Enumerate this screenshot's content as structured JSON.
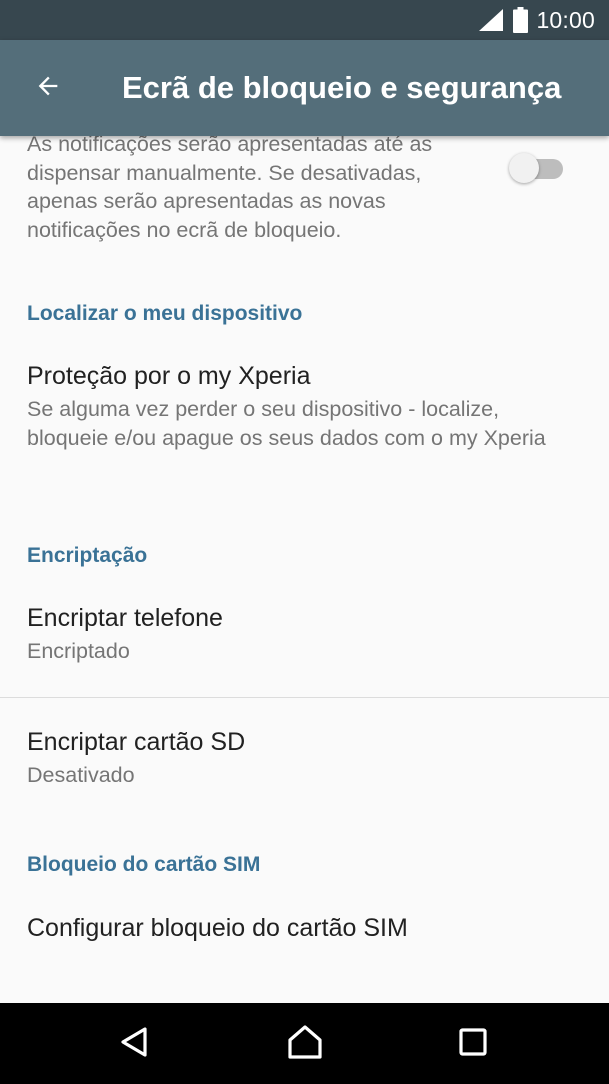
{
  "status_bar": {
    "time": "10:00",
    "icons": [
      "signal-icon",
      "battery-icon"
    ]
  },
  "app_bar": {
    "title": "Ecrã de bloqueio e segurança",
    "back_icon": "arrow-back-icon"
  },
  "notifications_setting": {
    "description": "As notificações serão apresentadas até as dispensar manualmente. Se desativadas, apenas serão apresentadas as novas notificações no ecrã de bloqueio.",
    "toggle_state": "off"
  },
  "sections": {
    "find_device": {
      "header": "Localizar o meu dispositivo",
      "item": {
        "title": "Proteção por o my Xperia",
        "summary": "Se alguma vez perder o seu dispositivo - localize, bloqueie e/ou apague os seus dados com o my Xperia"
      }
    },
    "encryption": {
      "header": "Encriptação",
      "phone": {
        "title": "Encriptar telefone",
        "summary": "Encriptado"
      },
      "sd_card": {
        "title": "Encriptar cartão SD",
        "summary": "Desativado"
      }
    },
    "sim_lock": {
      "header": "Bloqueio do cartão SIM",
      "item": {
        "title": "Configurar bloqueio do cartão SIM"
      }
    }
  },
  "nav_bar": {
    "buttons": [
      "back-icon",
      "home-icon",
      "recents-icon"
    ]
  },
  "colors": {
    "status_bar": "#37474f",
    "app_bar": "#546e7a",
    "section_header": "#3a7296",
    "background": "#fafafa",
    "nav_bar": "#000000"
  }
}
